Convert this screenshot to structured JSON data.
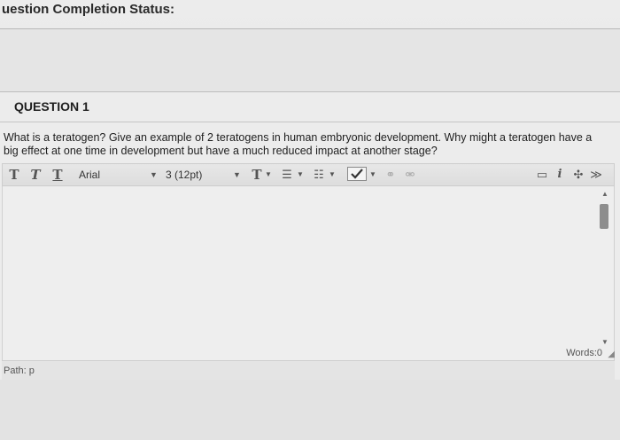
{
  "status": {
    "title": "uestion Completion Status:"
  },
  "question": {
    "title": "QUESTION 1",
    "prompt": "What is a teratogen? Give an example of 2 teratogens in human embryonic development. Why might a teratogen have a big effect at one time in development but have a much reduced impact at another stage?"
  },
  "toolbar": {
    "bold_label": "T",
    "italic_label": "T",
    "underline_label": "T",
    "font_family": "Arial",
    "font_size": "3 (12pt)",
    "text_color_label": "T",
    "icons": [
      "text-color-icon",
      "bullet-list-icon",
      "numbered-list-icon",
      "spellcheck-icon",
      "link-icon",
      "unlink-icon",
      "preview-icon",
      "info-icon",
      "fullscreen-icon",
      "collapse-icon"
    ]
  },
  "editor": {
    "content": "",
    "word_count": "Words:0"
  },
  "path_bar": {
    "text": "Path: p"
  }
}
